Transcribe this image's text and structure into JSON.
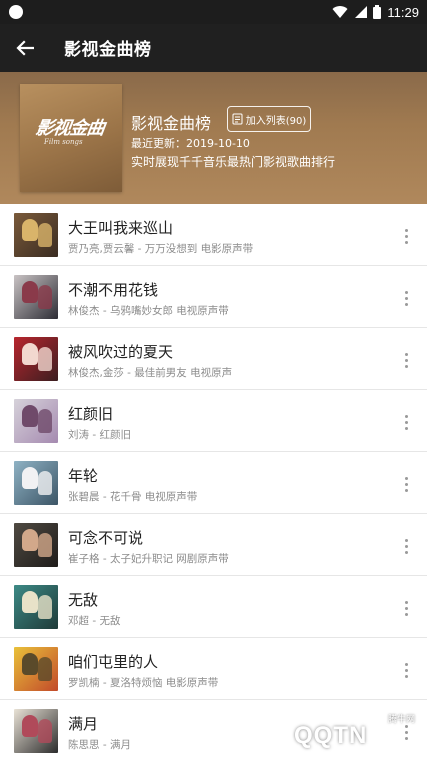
{
  "status_bar": {
    "time": "11:29"
  },
  "app_bar": {
    "title": "影视金曲榜"
  },
  "playlist": {
    "cover_title": "影视金曲",
    "cover_subtitle": "Film songs",
    "name": "影视金曲榜",
    "add_button": "加入列表(90)",
    "updated": "最近更新：2019-10-10",
    "description": "实时展现千千音乐最热门影视歌曲排行"
  },
  "songs": [
    {
      "title": "大王叫我来巡山",
      "meta": "贾乃亮,贾云馨 - 万万没想到 电影原声带",
      "c1": "#7a5a3a",
      "c2": "#d9b46a",
      "c3": "#3a2c22"
    },
    {
      "title": "不潮不用花钱",
      "meta": "林俊杰 - 乌鸦嘴妙女郎 电视原声带",
      "c1": "#c9c3c4",
      "c2": "#8a3a4a",
      "c3": "#2d2d35"
    },
    {
      "title": "被风吹过的夏天",
      "meta": "林俊杰,金莎 - 最佳前男友 电视原声",
      "c1": "#b8262e",
      "c2": "#f2d8cf",
      "c3": "#3b1e20"
    },
    {
      "title": "红颜旧",
      "meta": "刘涛 - 红颜旧",
      "c1": "#d6d2da",
      "c2": "#6f4a6a",
      "c3": "#a58ab0"
    },
    {
      "title": "年轮",
      "meta": "张碧晨 - 花千骨 电视原声带",
      "c1": "#8fb2c4",
      "c2": "#f1f1f3",
      "c3": "#3c5566"
    },
    {
      "title": "可念不可说",
      "meta": "崔子格 - 太子妃升职记 网剧原声带",
      "c1": "#4f4a42",
      "c2": "#d2a88a",
      "c3": "#1f1c1a"
    },
    {
      "title": "无敌",
      "meta": "邓超 - 无敌",
      "c1": "#3d8a86",
      "c2": "#e8e2c8",
      "c3": "#1e3a38"
    },
    {
      "title": "咱们屯里的人",
      "meta": "罗凯楠 - 夏洛特烦恼 电影原声带",
      "c1": "#e9c13a",
      "c2": "#5a4a2a",
      "c3": "#c24a2a"
    },
    {
      "title": "满月",
      "meta": "陈思思 - 满月",
      "c1": "#e9e2d6",
      "c2": "#b04a5a",
      "c3": "#2c2c2c"
    }
  ],
  "watermark": {
    "text": "QQTN",
    "small": "腾牛网"
  },
  "icons": {
    "back": "arrow-left-icon",
    "wifi": "wifi-icon",
    "signal": "signal-icon",
    "battery": "battery-icon",
    "more": "more-vertical-icon",
    "add": "add-to-list-icon"
  }
}
